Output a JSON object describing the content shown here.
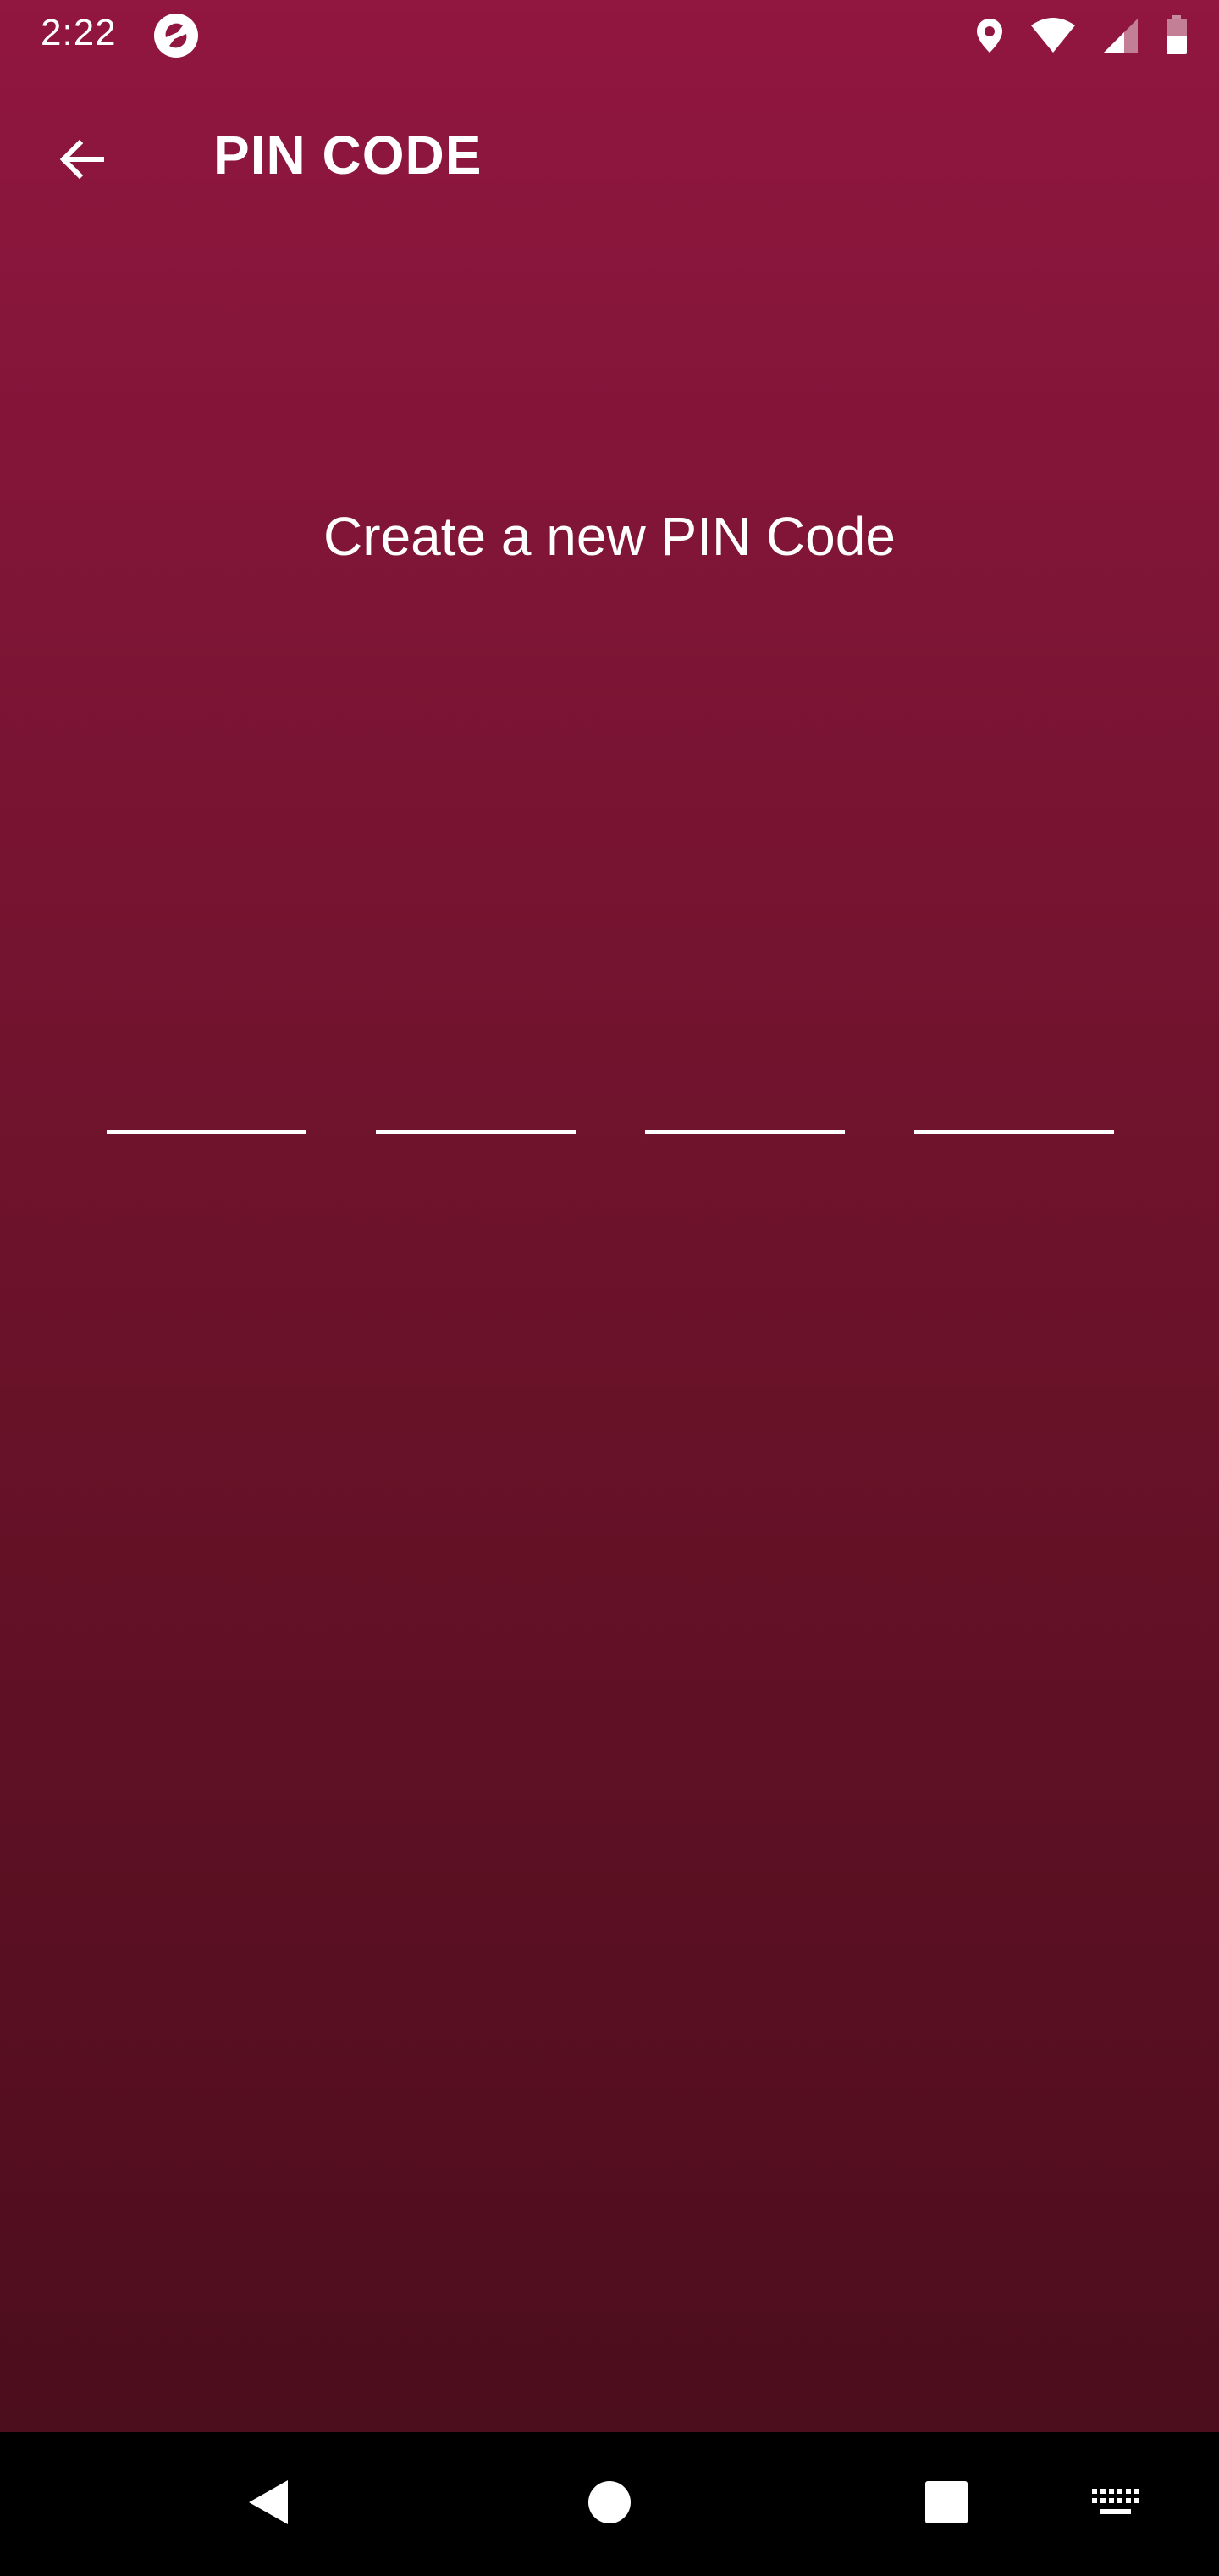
{
  "status_bar": {
    "time": "2:22",
    "icons": [
      "app-notification-icon",
      "location-icon",
      "wifi-icon",
      "signal-icon",
      "battery-icon"
    ]
  },
  "app_bar": {
    "back_icon": "arrow-left-icon",
    "title": "PIN CODE"
  },
  "main": {
    "prompt": "Create a new PIN Code",
    "pin_length": 4,
    "pin_digits": [
      "",
      "",
      "",
      ""
    ]
  },
  "nav_bar": {
    "icons": [
      "back-triangle-icon",
      "home-circle-icon",
      "recents-square-icon",
      "keyboard-icon"
    ]
  },
  "colors": {
    "gradient_top": "#911640",
    "gradient_bottom": "#4c0d1c",
    "text": "#ffffff",
    "nav_bar": "#000000"
  }
}
